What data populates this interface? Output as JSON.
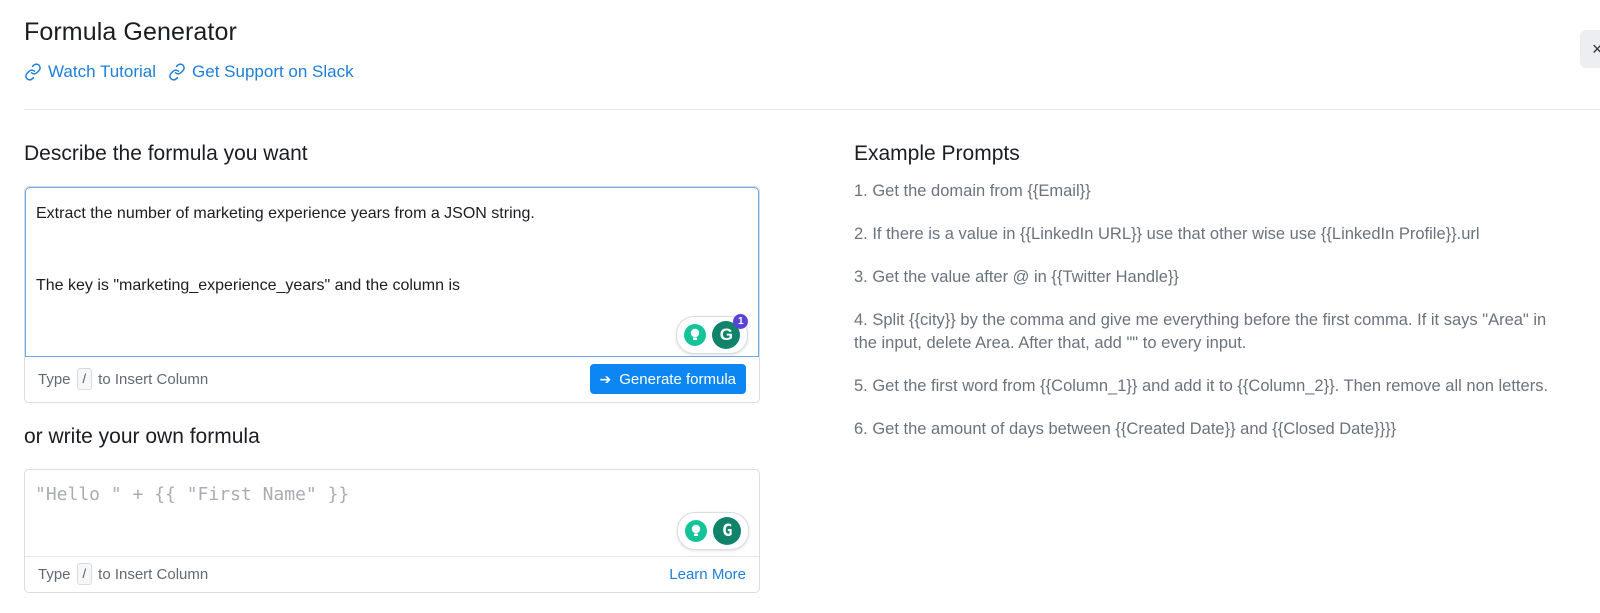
{
  "header": {
    "title": "Formula Generator",
    "links": [
      {
        "label": "Watch Tutorial",
        "icon": "link-icon"
      },
      {
        "label": "Get Support on Slack",
        "icon": "link-icon"
      }
    ],
    "close_label": "×"
  },
  "describe": {
    "heading": "Describe the formula you want",
    "text_line1": "Extract the number of marketing experience years from a JSON string.",
    "text_line2": "The key is \"marketing_experience_years\" and the column is",
    "hint_type": "Type",
    "hint_key": "/",
    "hint_rest": "to Insert Column",
    "generate_label": "Generate formula",
    "grammarly_badge": "1"
  },
  "own_formula": {
    "heading": "or write your own formula",
    "placeholder": "\"Hello \" + {{ \"First Name\" }}",
    "hint_type": "Type",
    "hint_key": "/",
    "hint_rest": "to Insert Column",
    "learn_more": "Learn More"
  },
  "examples": {
    "heading": "Example Prompts",
    "items": [
      "1. Get the domain from {{Email}}",
      "2. If there is a value in {{LinkedIn URL}} use that other wise use {{LinkedIn Profile}}.url",
      "3. Get the value after @ in {{Twitter Handle}}",
      "4. Split {{city}} by the comma and give me everything before the first comma. If it says \"Area\" in the input, delete Area. After that, add \"\" to every input.",
      "5. Get the first word from {{Column_1}} and add it to {{Column_2}}. Then remove all non letters.",
      "6. Get the amount of days between {{Created Date}} and {{Closed Date}}}}"
    ]
  },
  "colors": {
    "accent": "#0c86f2",
    "link": "#1d7fd8",
    "grammarly_green": "#11836a"
  }
}
